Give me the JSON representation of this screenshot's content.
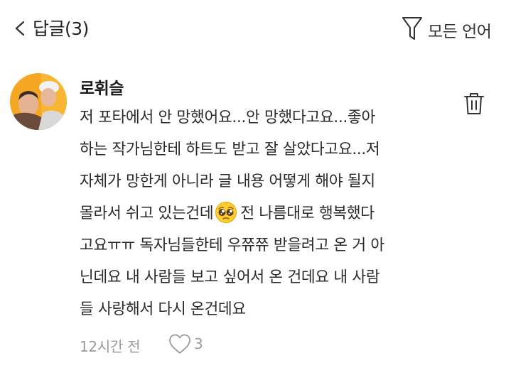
{
  "header": {
    "title": "답글(3)",
    "filter_label": "모든 언어"
  },
  "comment": {
    "author": "로휘슬",
    "lines": [
      "저 포타에서 안 망했어요...안 망했다고요...좋아",
      "하는 작가님한테 하트도 받고 잘 살았다고요...저",
      "자체가 망한게 아니라 글 내용 어떻게 해야 될지",
      "몰라서 쉬고 있는건데",
      "고요ㅠㅠ 독자님들한테 우쮸쮸 받을려고 온 거 아",
      "닌데요 내 사람들 보고 싶어서 온 건데요 내 사람",
      "들 사랑해서 다시 온건데요"
    ],
    "line4_after_emoji": "전 나름대로 행복했다",
    "emoji": "pleading-face-emoji",
    "timestamp": "12시간 전",
    "like_count": "3"
  },
  "colors": {
    "text": "#2a2a2a",
    "meta_gray": "#9a9a9a",
    "icon": "#333333",
    "avatar_bg": "#f5a623"
  }
}
